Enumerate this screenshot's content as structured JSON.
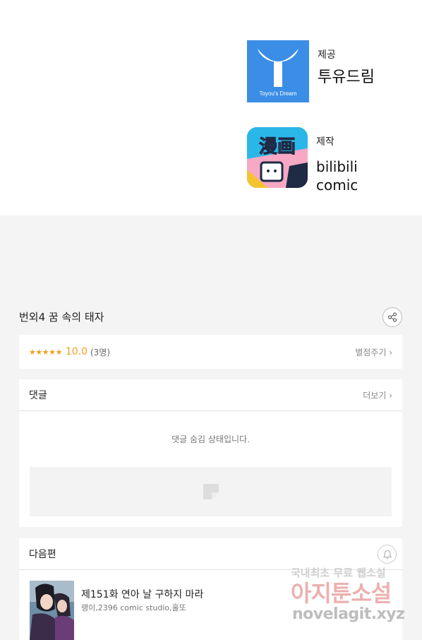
{
  "credits": {
    "provider": {
      "role": "제공",
      "name": "투유드림",
      "logo_caption": "Toyou's Dream",
      "color": "#3b8ee6"
    },
    "producer": {
      "role": "제작",
      "name_line1": "bilibili",
      "name_line2": "comic",
      "logo_text": "漫画"
    }
  },
  "episode": {
    "title": "번외4 꿈 속의 태자"
  },
  "rating": {
    "stars": "★★★★★",
    "score": "10.0",
    "count": "(3명)",
    "rate_link": "별점주기 ›",
    "accent": "#f0a020"
  },
  "comments": {
    "label": "댓글",
    "more_link": "더보기 ›",
    "hidden_message": "댓글 숨김 상태입니다."
  },
  "next": {
    "label": "다음편",
    "item_title": "제151화 연아 날 구하지 마라",
    "item_authors": "랭이,2396 comic studio,홀또"
  },
  "watermark": {
    "line1": "국내최초 무료 웹소설",
    "line2": "아지툰소설",
    "line3": "novelagit.xyz"
  }
}
